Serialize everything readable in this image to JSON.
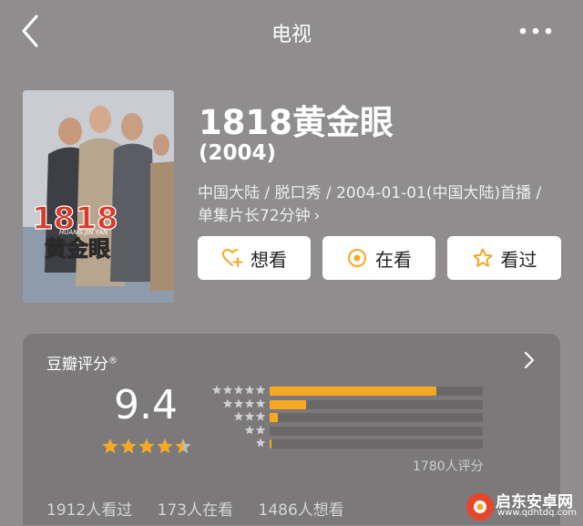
{
  "nav": {
    "title": "电视",
    "back_icon": "back-chevron-icon",
    "more_icon": "more-dots-icon"
  },
  "show": {
    "title": "1818黄金眼",
    "year": "(2004)",
    "meta": "中国大陆 / 脱口秀 / 2004-01-01(中国大陆)首播 / 单集片长72分钟",
    "poster": {
      "top_text": "1818",
      "latin": "HUANG JIN YAN",
      "cn": "黄金眼"
    }
  },
  "actions": [
    {
      "label": "想看",
      "icon": "heart-plus-icon"
    },
    {
      "label": "在看",
      "icon": "target-circle-icon"
    },
    {
      "label": "看过",
      "icon": "star-outline-icon"
    }
  ],
  "rating": {
    "label": "豆瓣评分",
    "mark": "®",
    "score": "9.4",
    "stars": 4.5,
    "distribution": [
      {
        "stars": 5,
        "fraction": 0.78
      },
      {
        "stars": 4,
        "fraction": 0.17
      },
      {
        "stars": 3,
        "fraction": 0.04
      },
      {
        "stars": 2,
        "fraction": 0.0
      },
      {
        "stars": 1,
        "fraction": 0.01
      }
    ],
    "total": "1780人评分"
  },
  "stats": {
    "watched": "1912人看过",
    "watching": "173人在看",
    "want": "1486人想看"
  },
  "colors": {
    "accent": "#f6a823",
    "background": "#8f8d8d",
    "card": "#7b7979"
  },
  "watermark": {
    "name": "启东安卓网",
    "url": "www.qdhtdq.com"
  }
}
